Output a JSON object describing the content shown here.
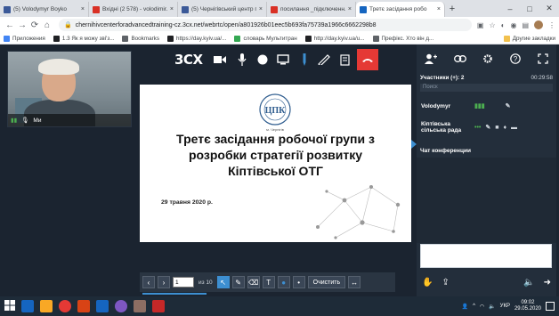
{
  "browser": {
    "tabs": [
      {
        "title": "(5) Volodymyr Boyko",
        "favicon_color": "#3b5998",
        "active": false
      },
      {
        "title": "Вхідні (2 578) - volodimir.bo",
        "favicon_color": "#d93025",
        "active": false
      },
      {
        "title": "(5) Чернігівський центр п...",
        "favicon_color": "#3b5998",
        "active": false
      },
      {
        "title": "посилання _підключенн...",
        "favicon_color": "#d93025",
        "active": false
      },
      {
        "title": "Третє засідання робо",
        "favicon_color": "#1565c0",
        "active": true
      }
    ],
    "new_tab": "+",
    "window_controls": {
      "minimize": "–",
      "maximize": "□",
      "close": "✕"
    },
    "url": "chernihivcenterforadvancedtraining-cz.3cx.net/webrtc/open/a801926b01eec5b693fa75739a1966c6662298b8",
    "bookmarks": [
      {
        "label": "Приложения",
        "color": "#4285f4"
      },
      {
        "label": "1.3 Як я можу зві'з...",
        "color": "#202124"
      },
      {
        "label": "Bookmarks",
        "color": "#5f6368"
      },
      {
        "label": "https://day.kyiv.ua/...",
        "color": "#202124"
      },
      {
        "label": "словарь Мультитран",
        "color": "#34a853"
      },
      {
        "label": "http://day.kyiv.ua/u...",
        "color": "#202124"
      },
      {
        "label": "Префікс. Хто він д...",
        "color": "#5f6368"
      }
    ],
    "other_bookmarks": "Другие закладки"
  },
  "conference": {
    "logo": "3CX",
    "camera": {
      "name": "Ми"
    },
    "slide": {
      "title_lines": [
        "Третє засідання робочої групи з",
        "розробки стратегії розвитку",
        "Кіптівської ОТГ"
      ],
      "date": "29 травня 2020 р.",
      "logo_caption": "м. Чернігів"
    },
    "pager": {
      "current_page": "1",
      "of_label": "из 10"
    },
    "clear_label": "Очистить",
    "participants_header": "Участники (+): 2",
    "timer": "00:29:58",
    "search_placeholder": "Поиск",
    "participants": [
      {
        "name": "Volodymyr"
      },
      {
        "name": "Кіптівська сільська рада"
      }
    ],
    "chat_header": "Чат конференции"
  },
  "taskbar": {
    "language": "УКР",
    "time": "09:02",
    "date": "29.05.2020"
  }
}
